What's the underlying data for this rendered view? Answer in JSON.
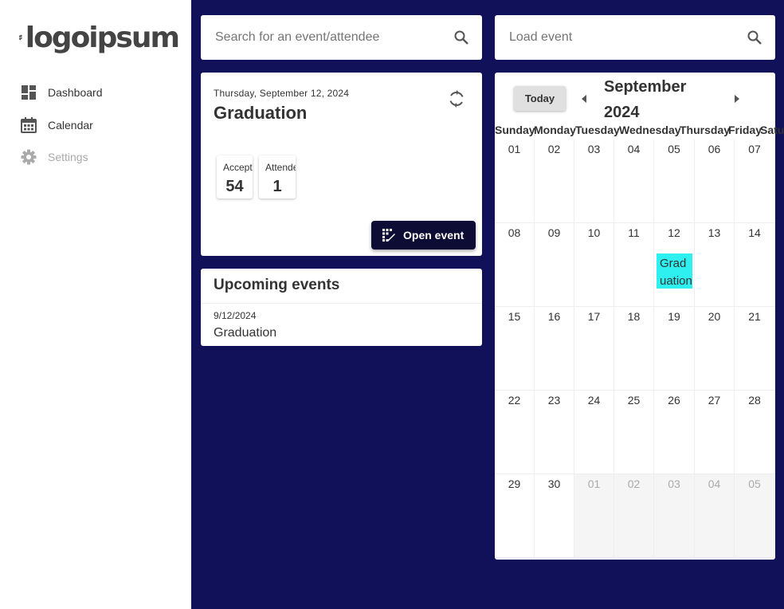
{
  "brand": {
    "logo_text": "logoipsum"
  },
  "sidebar": {
    "items": [
      {
        "label": "Dashboard",
        "icon": "dashboard-icon"
      },
      {
        "label": "Calendar",
        "icon": "calendar-icon"
      },
      {
        "label": "Settings",
        "icon": "gear-icon",
        "disabled": true
      }
    ]
  },
  "search": {
    "placeholder": "Search for an event/attendee"
  },
  "load": {
    "placeholder": "Load event"
  },
  "event": {
    "date": "Thursday, September 12, 2024",
    "title": "Graduation",
    "stats": [
      {
        "label": "Accepted",
        "value": "54"
      },
      {
        "label": "Attended",
        "value": "1"
      }
    ],
    "open_label": "Open event"
  },
  "upcoming": {
    "title": "Upcoming events",
    "items": [
      {
        "date": "9/12/2024",
        "name": "Graduation"
      }
    ]
  },
  "calendar": {
    "today_label": "Today",
    "month": "September",
    "year": "2024",
    "weekdays": [
      "Sunday",
      "Monday",
      "Tuesday",
      "Wednesday",
      "Thursday",
      "Friday",
      "Saturday"
    ],
    "weeks": [
      [
        "01",
        "02",
        "03",
        "04",
        "05",
        "06",
        "07"
      ],
      [
        "08",
        "09",
        "10",
        "11",
        "12",
        "13",
        "14"
      ],
      [
        "15",
        "16",
        "17",
        "18",
        "19",
        "20",
        "21"
      ],
      [
        "22",
        "23",
        "24",
        "25",
        "26",
        "27",
        "28"
      ],
      [
        "29",
        "30",
        "01",
        "02",
        "03",
        "04",
        "05"
      ]
    ],
    "other_month_start": 2,
    "events": [
      {
        "week": 1,
        "day": 4,
        "label": "Graduation",
        "color": "#2ef0f0"
      }
    ]
  },
  "colors": {
    "background": "#11115a",
    "accent": "#0c0c35",
    "event": "#2ef0f0"
  }
}
